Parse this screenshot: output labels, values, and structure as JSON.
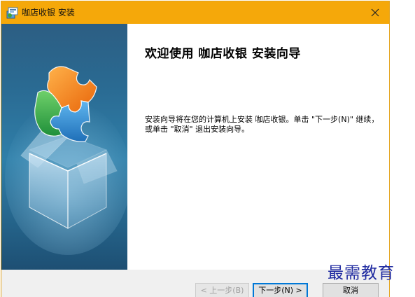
{
  "window": {
    "title": "咖店收银 安装",
    "title_icon": "installer-icon",
    "close_icon": "close-icon"
  },
  "colors": {
    "titlebar": "#f5a80a",
    "sidebar": "#2a6a92",
    "content_bg": "#ffffff",
    "watermark": "#1f2aa0"
  },
  "content": {
    "heading": "欢迎使用  咖店收银  安装向导",
    "body": "安装向导将在您的计算机上安装 咖店收银。单击 \"下一步(N)\" 继续，或单击 \"取消\" 退出安装向导。"
  },
  "buttons": {
    "back": "< 上一步(B)",
    "next": "下一步(N) >",
    "cancel": "取消"
  },
  "watermark": "最需教育"
}
